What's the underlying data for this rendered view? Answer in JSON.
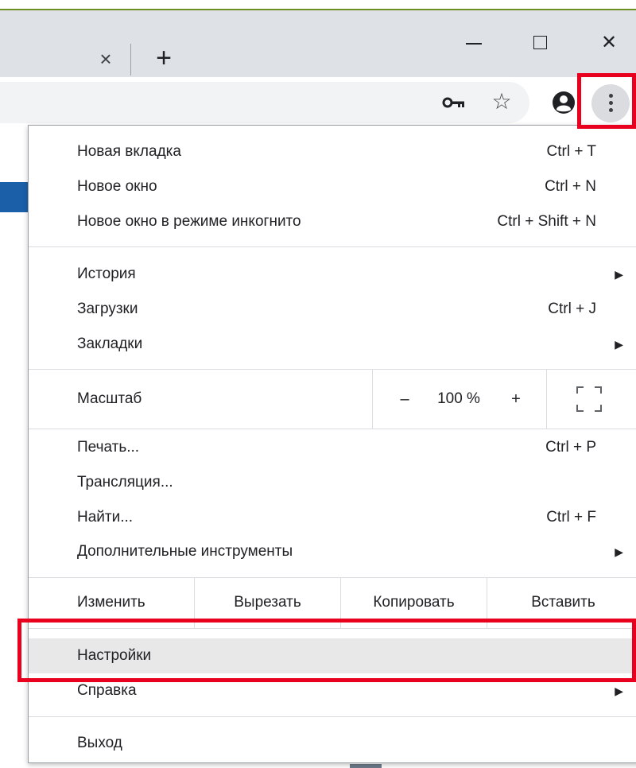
{
  "window": {
    "tab_close_glyph": "×",
    "new_tab_glyph": "+",
    "minimize_icon": "minimize-icon",
    "maximize_icon": "maximize-icon",
    "close_glyph": "✕"
  },
  "toolbar": {
    "icons": [
      "key-icon",
      "star-icon",
      "profile-icon",
      "more-vert-icon"
    ],
    "star_glyph": "☆"
  },
  "menu": {
    "group1": [
      {
        "label": "Новая вкладка",
        "shortcut": "Ctrl + T"
      },
      {
        "label": "Новое окно",
        "shortcut": "Ctrl + N"
      },
      {
        "label": "Новое окно в режиме инкогнито",
        "shortcut": "Ctrl + Shift + N"
      }
    ],
    "group2": [
      {
        "label": "История",
        "arrow": "▶"
      },
      {
        "label": "Загрузки",
        "shortcut": "Ctrl + J"
      },
      {
        "label": "Закладки",
        "arrow": "▶"
      }
    ],
    "zoom": {
      "label": "Масштаб",
      "minus": "–",
      "value": "100 %",
      "plus": "+"
    },
    "group3": [
      {
        "label": "Печать...",
        "shortcut": "Ctrl + P"
      },
      {
        "label": "Трансляция..."
      },
      {
        "label": "Найти...",
        "shortcut": "Ctrl + F"
      },
      {
        "label": "Дополнительные инструменты",
        "arrow": "▶"
      }
    ],
    "edit": {
      "label": "Изменить",
      "cut": "Вырезать",
      "copy": "Копировать",
      "paste": "Вставить"
    },
    "settings": {
      "label": "Настройки"
    },
    "help": {
      "label": "Справка",
      "arrow": "▶"
    },
    "exit": {
      "label": "Выход"
    }
  },
  "colors": {
    "highlight": "#e8001e",
    "hover_bg": "#e8e8e8",
    "menu_button_bg": "#dadce0"
  }
}
